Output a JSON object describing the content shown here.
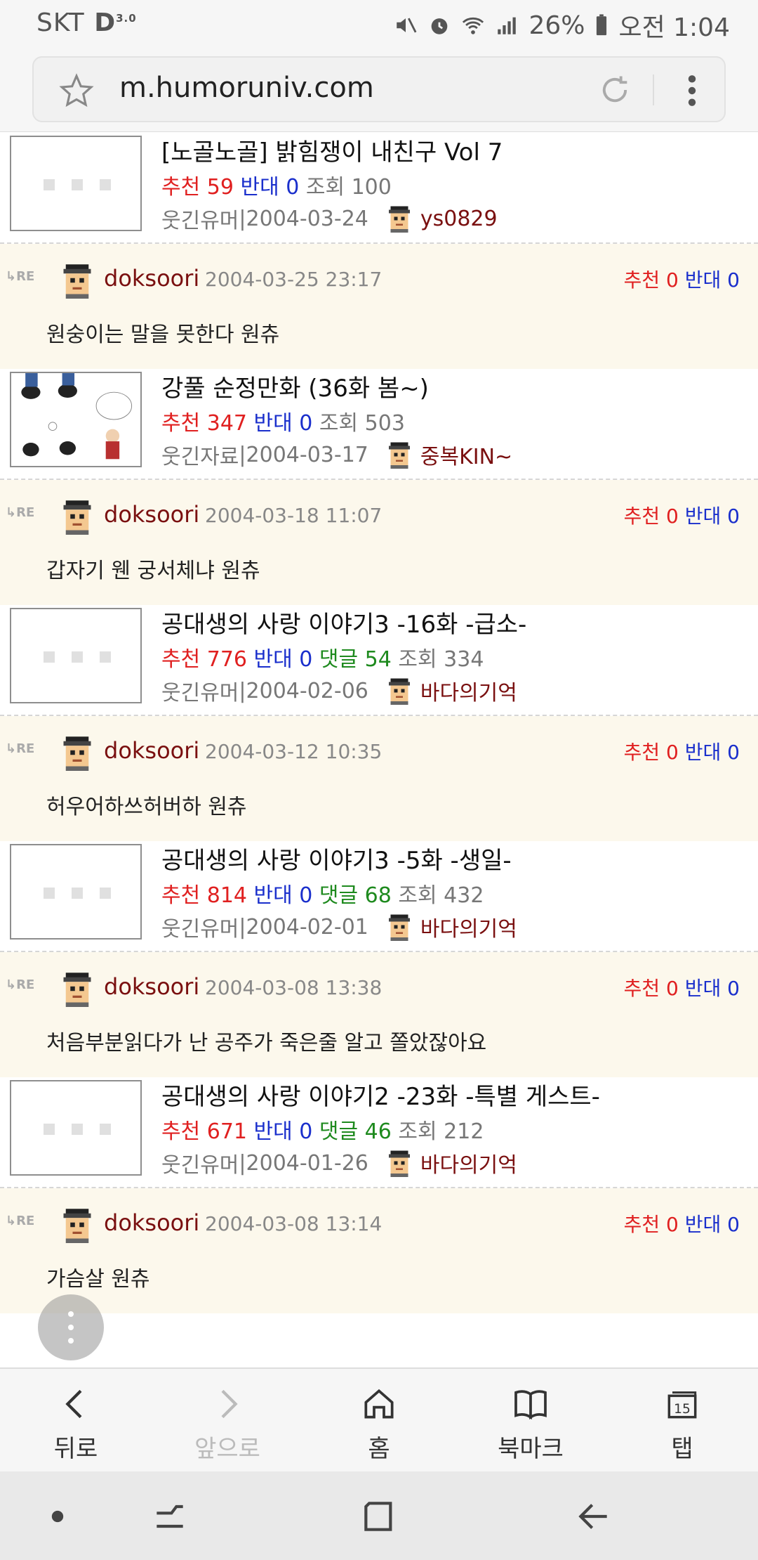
{
  "status": {
    "carrier": "SKT",
    "network": "3.0",
    "battery": "26%",
    "time": "오전 1:04"
  },
  "browser": {
    "url": "m.humoruniv.com"
  },
  "labels": {
    "recommend": "추천",
    "oppose": "반대",
    "comments": "댓글",
    "views": "조회"
  },
  "feed": [
    {
      "post": {
        "title": "[노골노골] 밝힘쟁이 내친구 Vol 7",
        "recommend": "59",
        "oppose": "0",
        "comments": null,
        "views": "100",
        "board": "웃긴유머",
        "date": "2004-03-24",
        "author": "ys0829",
        "has_image": false
      },
      "reply": {
        "user": "doksoori",
        "datetime": "2004-03-25 23:17",
        "recommend": "0",
        "oppose": "0",
        "text": "원숭이는 말을 못한다 원츄"
      }
    },
    {
      "post": {
        "title": "강풀 순정만화 (36화 봄~)",
        "recommend": "347",
        "oppose": "0",
        "comments": null,
        "views": "503",
        "board": "웃긴자료",
        "date": "2004-03-17",
        "author": "중복KIN~",
        "has_image": true
      },
      "reply": {
        "user": "doksoori",
        "datetime": "2004-03-18 11:07",
        "recommend": "0",
        "oppose": "0",
        "text": "갑자기 웬 궁서체냐 원츄"
      }
    },
    {
      "post": {
        "title": "공대생의 사랑 이야기3 -16화 -급소-",
        "recommend": "776",
        "oppose": "0",
        "comments": "54",
        "views": "334",
        "board": "웃긴유머",
        "date": "2004-02-06",
        "author": "바다의기억",
        "has_image": false
      },
      "reply": {
        "user": "doksoori",
        "datetime": "2004-03-12 10:35",
        "recommend": "0",
        "oppose": "0",
        "text": "허우어하쓰허버하 원츄"
      }
    },
    {
      "post": {
        "title": "공대생의 사랑 이야기3 -5화 -생일-",
        "recommend": "814",
        "oppose": "0",
        "comments": "68",
        "views": "432",
        "board": "웃긴유머",
        "date": "2004-02-01",
        "author": "바다의기억",
        "has_image": false
      },
      "reply": {
        "user": "doksoori",
        "datetime": "2004-03-08 13:38",
        "recommend": "0",
        "oppose": "0",
        "text": "처음부분읽다가 난 공주가 죽은줄 알고 쫄았잖아요"
      }
    },
    {
      "post": {
        "title": "공대생의 사랑 이야기2 -23화 -특별 게스트-",
        "recommend": "671",
        "oppose": "0",
        "comments": "46",
        "views": "212",
        "board": "웃긴유머",
        "date": "2004-01-26",
        "author": "바다의기억",
        "has_image": false
      },
      "reply": {
        "user": "doksoori",
        "datetime": "2004-03-08 13:14",
        "recommend": "0",
        "oppose": "0",
        "text": "가슴살 원츄"
      }
    }
  ],
  "toolbar": {
    "back": "뒤로",
    "forward": "앞으로",
    "home": "홈",
    "bookmark": "북마크",
    "tabs": "탭",
    "tab_count": "15"
  },
  "colors": {
    "recommend": "#e02020",
    "oppose": "#1a2fcc",
    "comments": "#1e8a1e",
    "author": "#7a1010",
    "reply_bg": "#fcf8ec"
  }
}
